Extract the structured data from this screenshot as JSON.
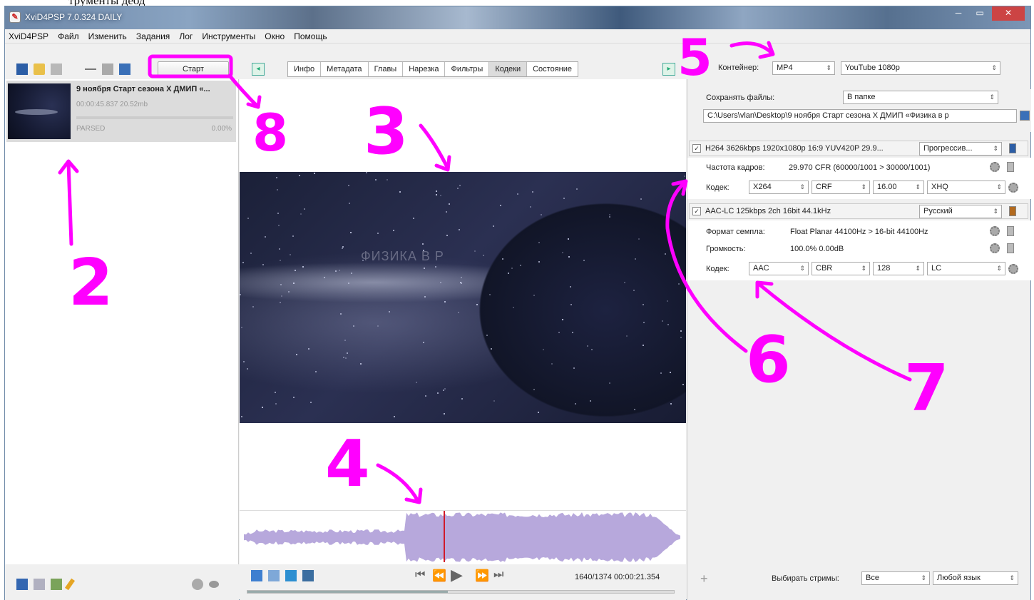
{
  "caption_text": "трументы деод",
  "window": {
    "title": "XviD4PSP 7.0.324 DAILY",
    "controls": [
      "─",
      "▭",
      "✕"
    ]
  },
  "menu": [
    "XviD4PSP",
    "Файл",
    "Изменить",
    "Задания",
    "Лог",
    "Инструменты",
    "Окно",
    "Помощь"
  ],
  "toolbar": {
    "start_label": "Старт",
    "tabs": [
      "Инфо",
      "Метадата",
      "Главы",
      "Нарезка",
      "Фильтры",
      "Кодеки",
      "Состояние"
    ],
    "active_tab": "Кодеки",
    "container_label": "Контейнер:",
    "container_value": "MP4",
    "preset_value": "YouTube 1080p"
  },
  "task": {
    "title": "9 ноября Старт сезона X ДМИП «...",
    "meta": "00:00:45.837 20.52mb",
    "status": "PARSED",
    "percent": "0.00%",
    "progress": 0
  },
  "output": {
    "save_label": "Сохранять файлы:",
    "save_mode": "В папке",
    "path": "C:\\Users\\vlan\\Desktop\\9 ноября Старт сезона X ДМИП «Физика в р"
  },
  "video_stream": {
    "checked": true,
    "summary": "H264 3626kbps 1920x1080p 16:9 YUV420P 29.9...",
    "scan": "Прогрессив...",
    "fps_label": "Частота кадров:",
    "fps_value": "29.970 CFR (60000/1001 > 30000/1001)",
    "codec_label": "Кодек:",
    "codec": "X264",
    "mode": "CRF",
    "quality": "16.00",
    "preset": "XHQ"
  },
  "audio_stream": {
    "checked": true,
    "summary": "AAC-LC 125kbps 2ch 16bit 44.1kHz",
    "language": "Русский",
    "format_label": "Формат семпла:",
    "format_value": "Float Planar 44100Hz > 16-bit 44100Hz",
    "volume_label": "Громкость:",
    "volume_value": "100.0% 0.00dB",
    "codec_label": "Кодек:",
    "codec": "AAC",
    "mode": "CBR",
    "bitrate": "128",
    "profile": "LC"
  },
  "preview": {
    "watermark": "ФИЗИКА В Р"
  },
  "player": {
    "timecode": "1640/1374 00:00:21.354",
    "seek_progress": 0.47
  },
  "streams_bar": {
    "label": "Выбирать стримы:",
    "streams_value": "Все",
    "language_value": "Любой язык"
  },
  "annotations": {
    "numbers": [
      "2",
      "3",
      "4",
      "5",
      "6",
      "7",
      "8"
    ],
    "color": "#ff00ff"
  },
  "colors": {
    "waveform": "#b7a8dc",
    "playhead": "#d01a2a",
    "annotation": "#ff00ff"
  }
}
